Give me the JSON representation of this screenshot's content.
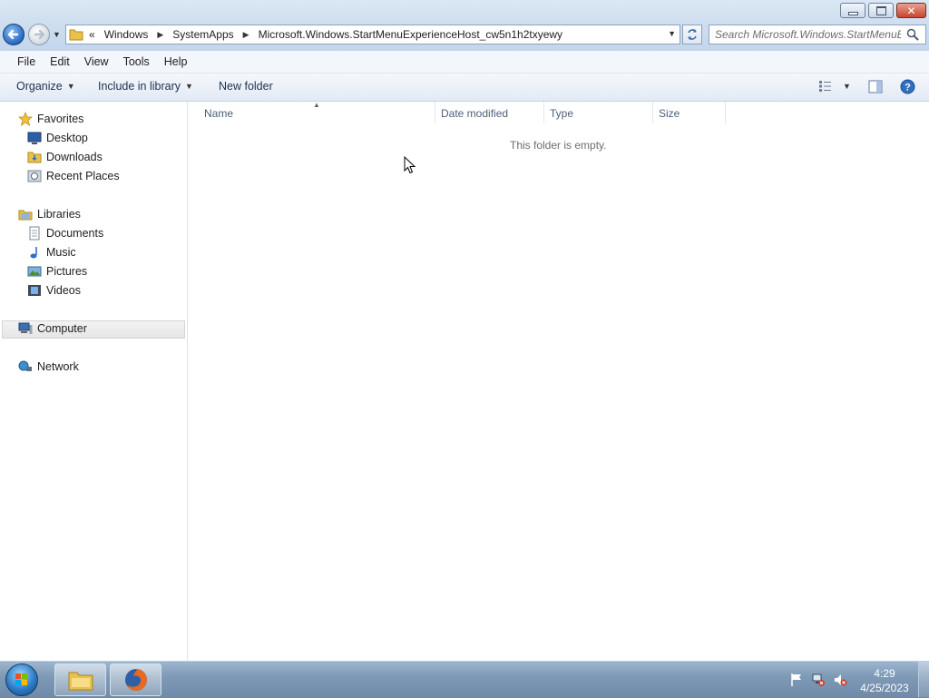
{
  "address_bar": {
    "overflow": "«",
    "crumbs": [
      "Windows",
      "SystemApps",
      "Microsoft.Windows.StartMenuExperienceHost_cw5n1h2txyewy"
    ]
  },
  "search": {
    "placeholder": "Search Microsoft.Windows.StartMenuE..."
  },
  "menu": {
    "file": "File",
    "edit": "Edit",
    "view": "View",
    "tools": "Tools",
    "help": "Help"
  },
  "toolbar": {
    "organize": "Organize",
    "include_in_library": "Include in library",
    "new_folder": "New folder"
  },
  "nav": {
    "favorites": "Favorites",
    "desktop": "Desktop",
    "downloads": "Downloads",
    "recent_places": "Recent Places",
    "libraries": "Libraries",
    "documents": "Documents",
    "music": "Music",
    "pictures": "Pictures",
    "videos": "Videos",
    "computer": "Computer",
    "network": "Network"
  },
  "columns": {
    "name": "Name",
    "date_modified": "Date modified",
    "type": "Type",
    "size": "Size"
  },
  "empty_message": "This folder is empty.",
  "clock": {
    "time": "4:29",
    "date": "4/25/2023"
  },
  "icons": {
    "back": "back-arrow-icon",
    "forward": "forward-arrow-icon",
    "folder": "folder-icon",
    "search": "search-icon",
    "refresh": "refresh-icon",
    "help": "help-icon",
    "start": "windows-start-icon",
    "explorer": "explorer-icon",
    "firefox": "firefox-icon"
  }
}
